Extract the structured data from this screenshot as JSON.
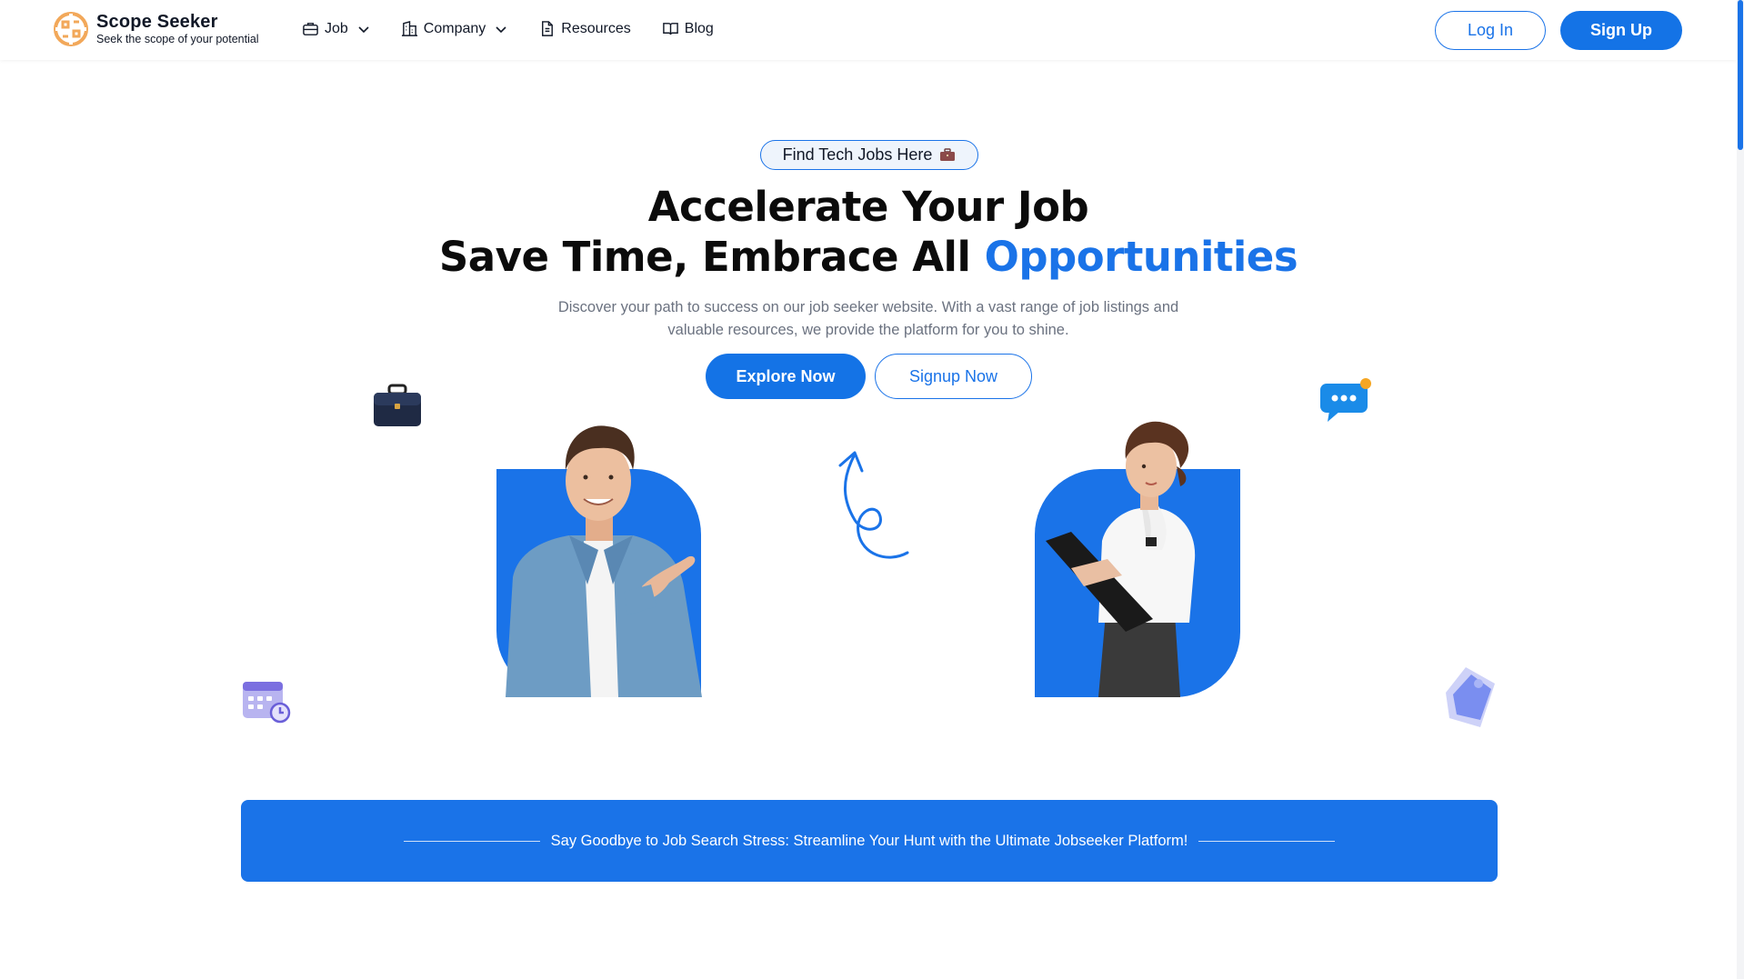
{
  "brand": {
    "name": "Scope Seeker",
    "tagline": "Seek the scope of your potential",
    "logo_color": "#f2a85a"
  },
  "nav": {
    "items": [
      {
        "label": "Job",
        "icon": "briefcase-icon",
        "has_dropdown": true
      },
      {
        "label": "Company",
        "icon": "building-icon",
        "has_dropdown": true
      },
      {
        "label": "Resources",
        "icon": "document-icon",
        "has_dropdown": false
      },
      {
        "label": "Blog",
        "icon": "book-icon",
        "has_dropdown": false
      }
    ],
    "login_label": "Log In",
    "signup_label": "Sign Up"
  },
  "hero": {
    "pill_label": "Find Tech Jobs Here",
    "pill_icon": "briefcase-emoji-icon",
    "heading_line1": "Accelerate Your Job",
    "heading_line2_prefix": "Save Time, Embrace All ",
    "heading_line2_accent": "Opportunities",
    "description": "Discover your path to success on our job seeker website. With a vast range of job listings and valuable resources, we provide the platform for you to shine.",
    "explore_label": "Explore Now",
    "signup_now_label": "Signup Now"
  },
  "banner": {
    "text": "Say Goodbye to Job Search Stress: Streamline Your Hunt with the Ultimate Jobseeker Platform!"
  },
  "colors": {
    "primary": "#1a73e8",
    "text": "#111827",
    "muted": "#6b7280"
  }
}
